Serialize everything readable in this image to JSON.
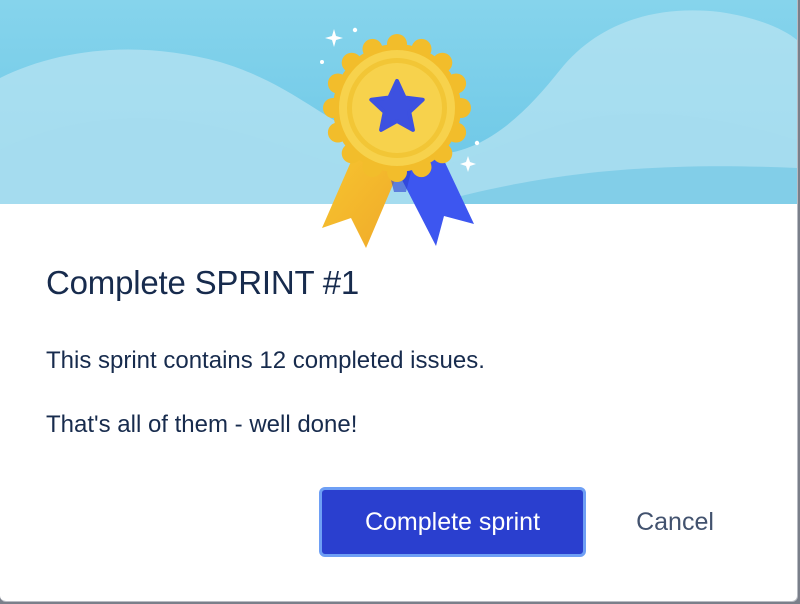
{
  "dialog": {
    "title": "Complete SPRINT #1",
    "message_line1": "This sprint contains 12 completed issues.",
    "message_line2": "That's all of them - well done!",
    "primary_label": "Complete sprint",
    "cancel_label": "Cancel"
  },
  "illustration": {
    "icon": "award-medal-icon"
  },
  "colors": {
    "sky_light": "#bfe6f3",
    "sky": "#7fd0ea",
    "medal_gold": "#f6d24a",
    "medal_border": "#f2bd2b",
    "star": "#3d51e0",
    "ribbon_blue": "#3d56f0",
    "ribbon_gold": "#f2bd2b",
    "primary_button": "#2a3fcf",
    "primary_focus_ring": "#6e9ff5",
    "title_text": "#172b4d",
    "cancel_text": "#42526e"
  }
}
